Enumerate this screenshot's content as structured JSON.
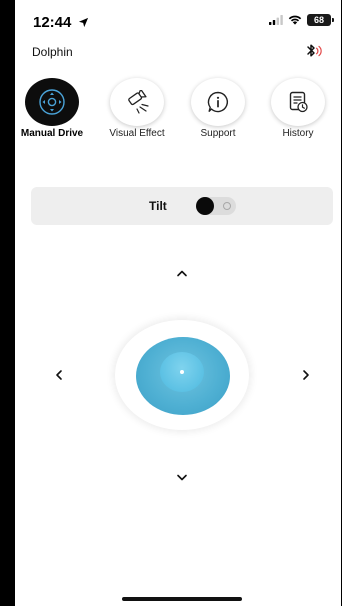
{
  "status_bar": {
    "time": "12:44",
    "battery": "68",
    "icons": [
      "location-arrow-icon",
      "signal-icon",
      "wifi-icon",
      "battery-icon"
    ]
  },
  "header": {
    "device_name": "Dolphin",
    "bluetooth_icon": "bluetooth-connected-icon"
  },
  "tabs": [
    {
      "label": "Manual Drive",
      "icon": "gamepad-icon",
      "active": true
    },
    {
      "label": "Visual Effect",
      "icon": "spotlight-icon",
      "active": false
    },
    {
      "label": "Support",
      "icon": "info-icon",
      "active": false
    },
    {
      "label": "History",
      "icon": "document-clock-icon",
      "active": false
    }
  ],
  "tilt": {
    "label": "Tilt",
    "enabled": false
  },
  "controls": {
    "up_icon": "chevron-up-icon",
    "down_icon": "chevron-down-icon",
    "left_icon": "chevron-left-icon",
    "right_icon": "chevron-right-icon"
  },
  "colors": {
    "active_tab": "#0d0d0d",
    "active_icon": "#4aa3d8",
    "joystick": "#4fb0d3",
    "joystick_knob": "#6ccbe8",
    "tilt_bar": "#eeeeee"
  }
}
